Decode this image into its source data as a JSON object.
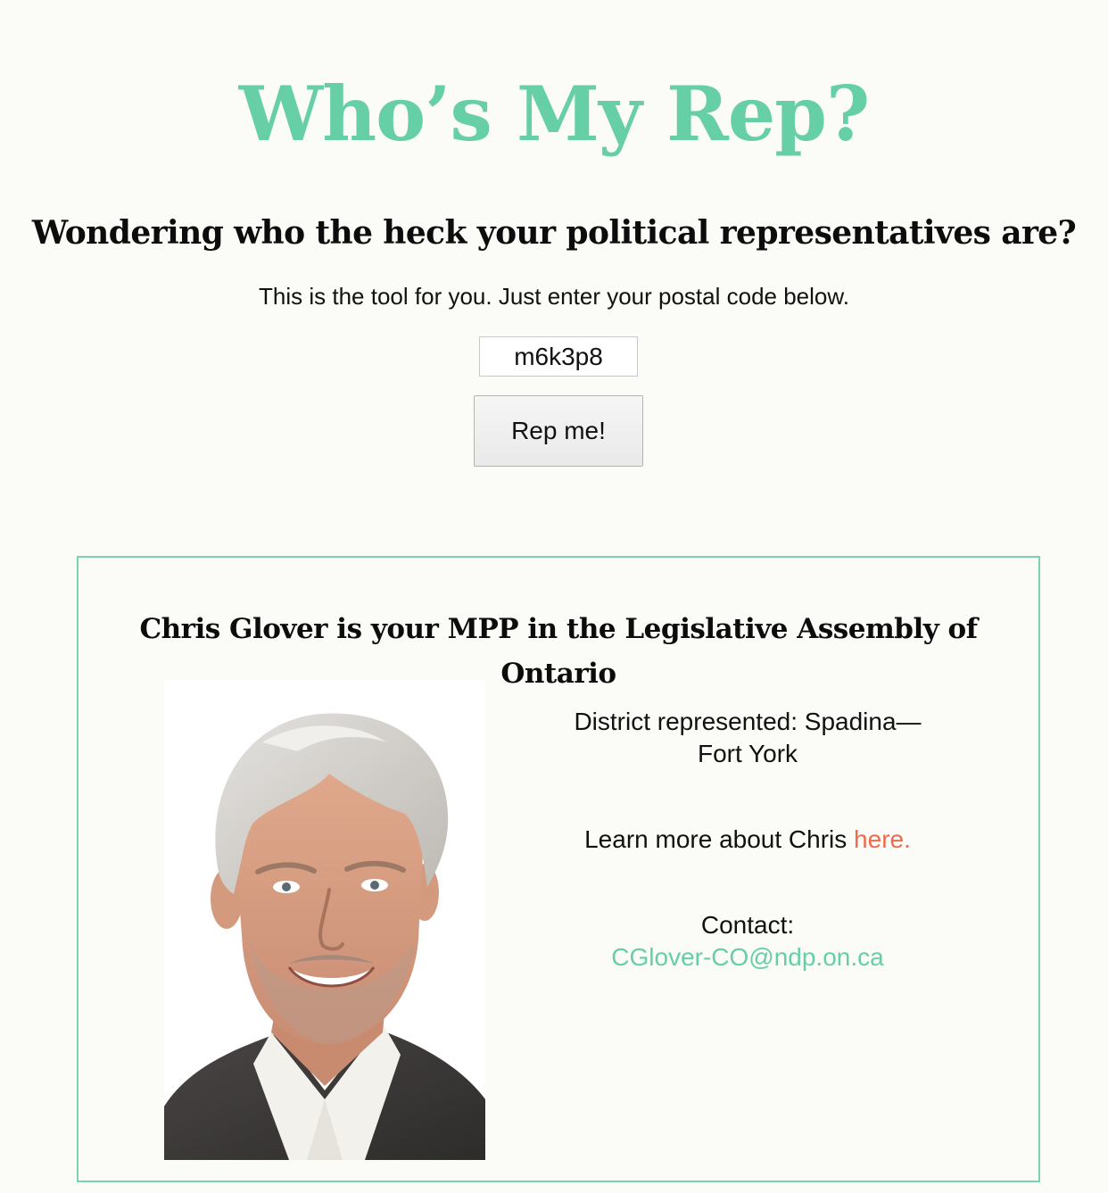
{
  "header": {
    "title": "Who’s My Rep?",
    "subtitle": "Wondering who the heck your political representatives are?",
    "intro": "This is the tool for you. Just enter your postal code below."
  },
  "search": {
    "postal_code_value": "m6k3p8",
    "submit_label": "Rep me!"
  },
  "result": {
    "heading": "Chris Glover is your MPP in the Legislative Assembly of Ontario",
    "district_text": "District represented: Spadina—Fort York",
    "learn_more_prefix": "Learn more about Chris ",
    "learn_more_link": "here.",
    "contact_label": "Contact:",
    "contact_email": "CGlover-CO@ndp.on.ca"
  },
  "colors": {
    "accent_green": "#66cfa6",
    "link_orange": "#ee6b4d",
    "page_background": "#fbfcf7"
  }
}
